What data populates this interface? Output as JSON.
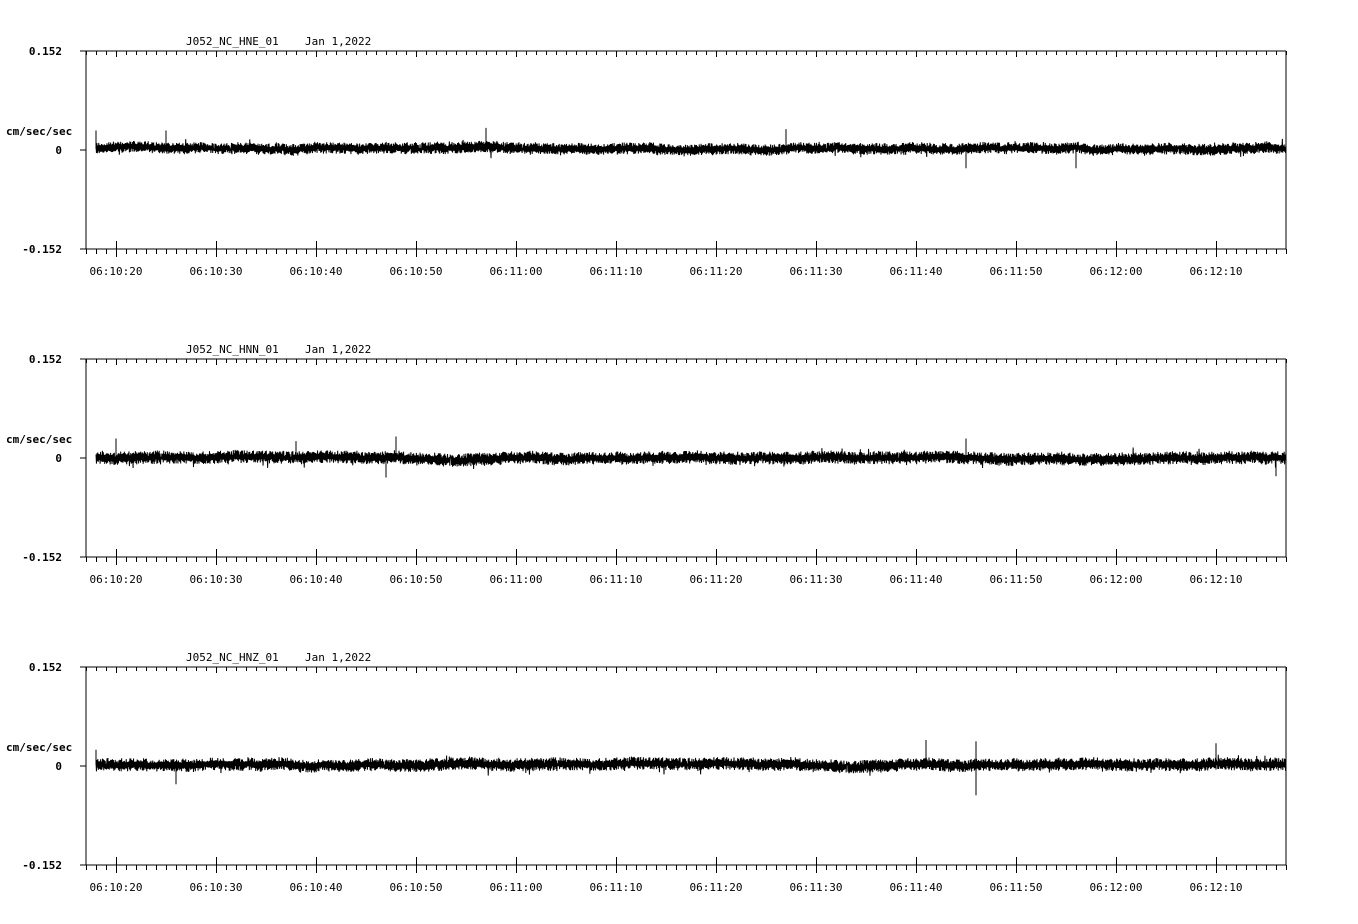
{
  "chart_data": [
    {
      "type": "line",
      "title": "J052_NC_HNE_01",
      "date": "Jan 1,2022",
      "ylabel": "cm/sec/sec",
      "ylim": [
        -0.152,
        0.152
      ],
      "yticks": [
        "0.152",
        "0",
        "-0.152"
      ],
      "xlim": [
        "06:10:17",
        "06:12:17"
      ],
      "xticks": [
        "06:10:20",
        "06:10:30",
        "06:10:40",
        "06:10:50",
        "06:11:00",
        "06:11:10",
        "06:11:20",
        "06:11:30",
        "06:11:40",
        "06:11:50",
        "06:12:00",
        "06:12:10"
      ],
      "trace": {
        "start": "06:10:18",
        "end": "06:12:17",
        "baseline": 0.002,
        "noise_amplitude": 0.009,
        "peak_amplitude": 0.03,
        "spikes": [
          {
            "t": "06:10:18",
            "v": 0.03
          },
          {
            "t": "06:10:25",
            "v": 0.03
          },
          {
            "t": "06:10:57",
            "v": 0.034
          },
          {
            "t": "06:11:27",
            "v": 0.032
          },
          {
            "t": "06:11:45",
            "v": -0.028
          },
          {
            "t": "06:11:56",
            "v": -0.028
          }
        ]
      }
    },
    {
      "type": "line",
      "title": "J052_NC_HNN_01",
      "date": "Jan 1,2022",
      "ylabel": "cm/sec/sec",
      "ylim": [
        -0.152,
        0.152
      ],
      "yticks": [
        "0.152",
        "0",
        "-0.152"
      ],
      "xlim": [
        "06:10:17",
        "06:12:17"
      ],
      "xticks": [
        "06:10:20",
        "06:10:30",
        "06:10:40",
        "06:10:50",
        "06:11:00",
        "06:11:10",
        "06:11:20",
        "06:11:30",
        "06:11:40",
        "06:11:50",
        "06:12:00",
        "06:12:10"
      ],
      "trace": {
        "start": "06:10:18",
        "end": "06:12:17",
        "baseline": 0.0,
        "noise_amplitude": 0.01,
        "peak_amplitude": 0.033,
        "spikes": [
          {
            "t": "06:10:20",
            "v": 0.03
          },
          {
            "t": "06:10:38",
            "v": 0.026
          },
          {
            "t": "06:10:48",
            "v": 0.033
          },
          {
            "t": "06:10:47",
            "v": -0.03
          },
          {
            "t": "06:11:45",
            "v": 0.03
          },
          {
            "t": "06:12:16",
            "v": -0.028
          }
        ]
      }
    },
    {
      "type": "line",
      "title": "J052_NC_HNZ_01",
      "date": "Jan 1,2022",
      "ylabel": "cm/sec/sec",
      "ylim": [
        -0.152,
        0.152
      ],
      "yticks": [
        "0.152",
        "0",
        "-0.152"
      ],
      "xlim": [
        "06:10:17",
        "06:12:17"
      ],
      "xticks": [
        "06:10:20",
        "06:10:30",
        "06:10:40",
        "06:10:50",
        "06:11:00",
        "06:11:10",
        "06:11:20",
        "06:11:30",
        "06:11:40",
        "06:11:50",
        "06:12:00",
        "06:12:10"
      ],
      "trace": {
        "start": "06:10:18",
        "end": "06:12:17",
        "baseline": 0.002,
        "noise_amplitude": 0.01,
        "peak_amplitude": 0.045,
        "spikes": [
          {
            "t": "06:10:18",
            "v": 0.025
          },
          {
            "t": "06:10:26",
            "v": -0.028
          },
          {
            "t": "06:11:41",
            "v": 0.04
          },
          {
            "t": "06:11:46",
            "v": 0.038
          },
          {
            "t": "06:11:46",
            "v": -0.045
          },
          {
            "t": "06:12:10",
            "v": 0.035
          }
        ]
      }
    }
  ]
}
